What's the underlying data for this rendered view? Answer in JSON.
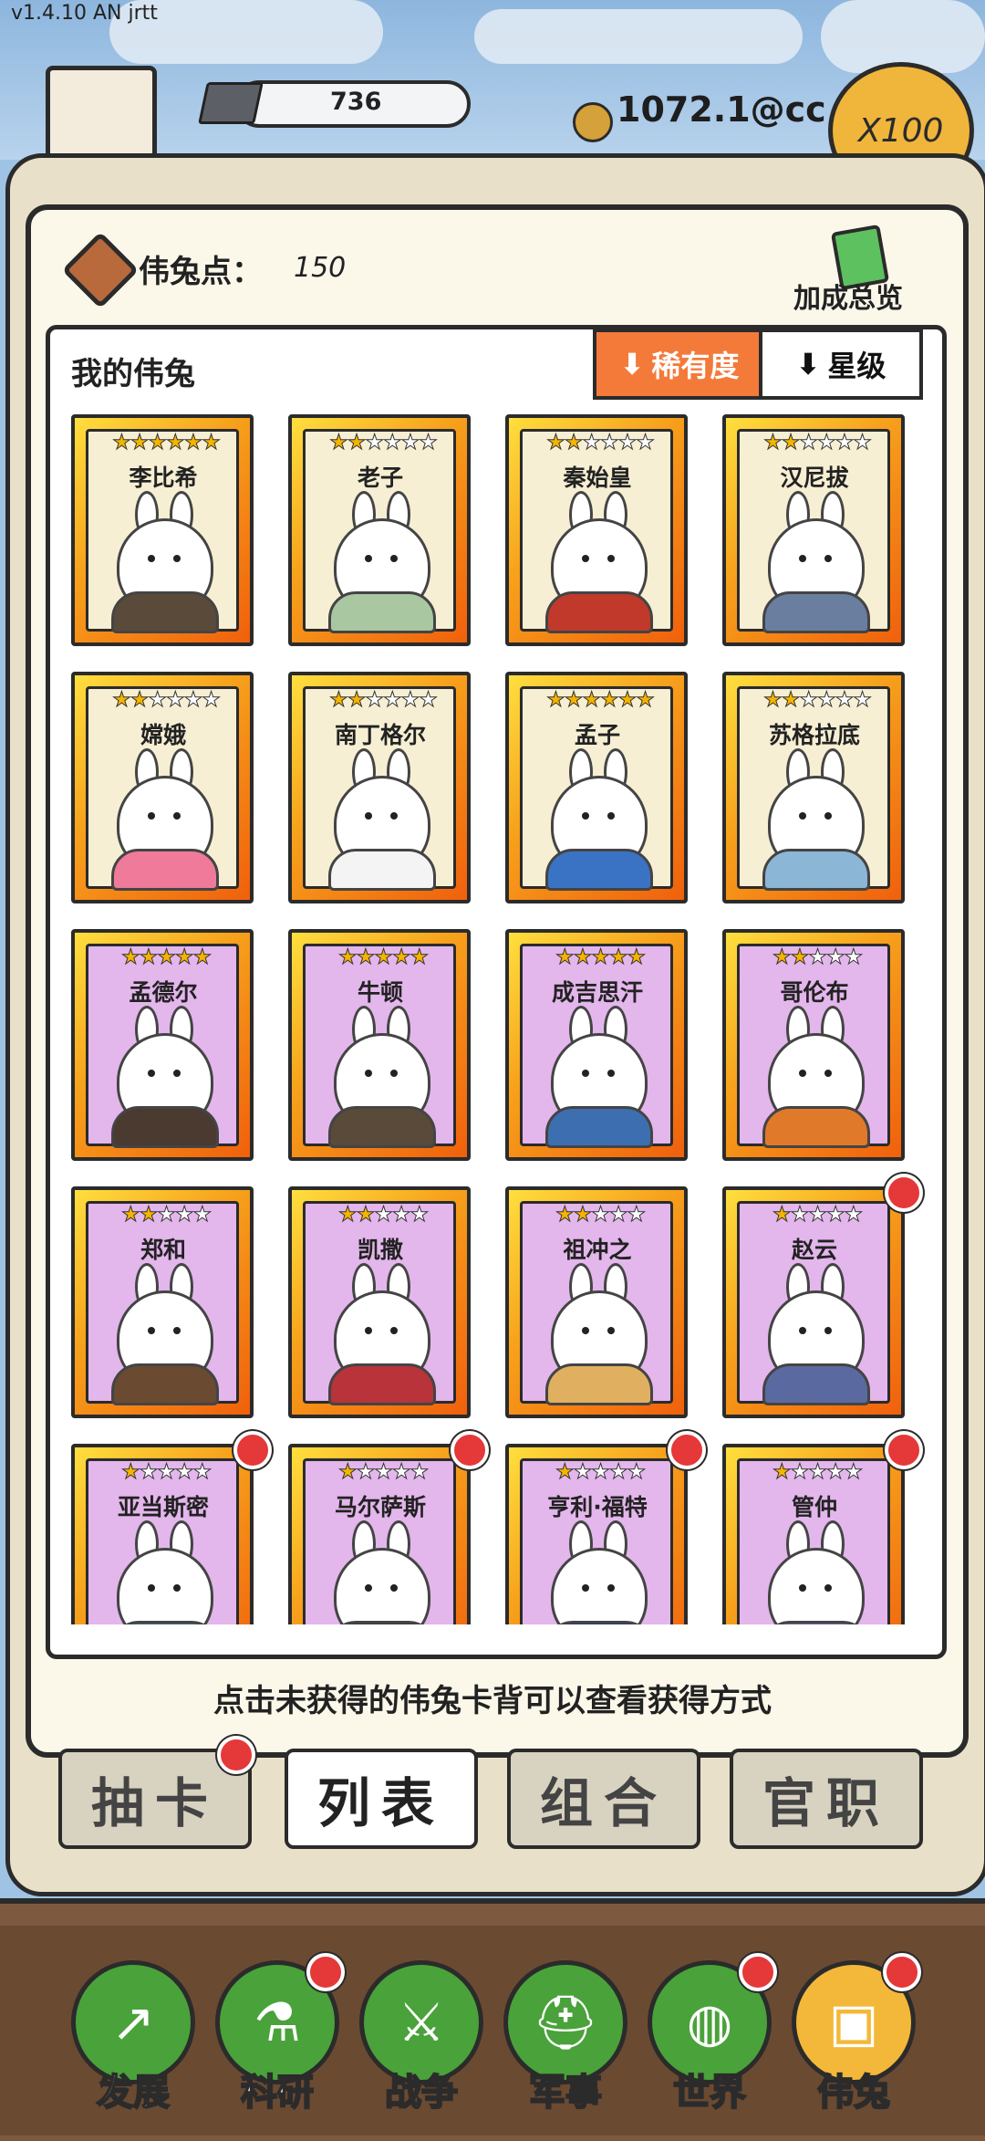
{
  "version": "v1.4.10 AN jrtt",
  "top": {
    "resource": "736",
    "coins": "1072.1@cc",
    "multiplier": "X100"
  },
  "panel": {
    "points_label": "伟兔点：",
    "points_value": "150",
    "bonus_label": "加成总览",
    "list_title": "我的伟兔",
    "sort_rarity": "稀有度",
    "sort_star": "星级",
    "hint": "点击未获得的伟兔卡背可以查看获得方式"
  },
  "cards": [
    {
      "name": "李比希",
      "stars": 6,
      "max": 6,
      "style": "gold",
      "robe": "#5a4a3a",
      "badge": false
    },
    {
      "name": "老子",
      "stars": 2,
      "max": 6,
      "style": "gold",
      "robe": "#a9c7a1",
      "badge": false
    },
    {
      "name": "秦始皇",
      "stars": 2,
      "max": 6,
      "style": "gold",
      "robe": "#c0392b",
      "badge": false
    },
    {
      "name": "汉尼拔",
      "stars": 2,
      "max": 6,
      "style": "gold",
      "robe": "#6a7ea0",
      "badge": false
    },
    {
      "name": "嫦娥",
      "stars": 2,
      "max": 6,
      "style": "gold",
      "robe": "#f07a9a",
      "badge": false
    },
    {
      "name": "南丁格尔",
      "stars": 2,
      "max": 6,
      "style": "gold",
      "robe": "#f4f4f4",
      "badge": false
    },
    {
      "name": "孟子",
      "stars": 6,
      "max": 6,
      "style": "gold",
      "robe": "#3b73c4",
      "badge": false
    },
    {
      "name": "苏格拉底",
      "stars": 2,
      "max": 6,
      "style": "gold",
      "robe": "#8cb6d6",
      "badge": false
    },
    {
      "name": "孟德尔",
      "stars": 5,
      "max": 5,
      "style": "purple",
      "robe": "#4a3a30",
      "badge": false
    },
    {
      "name": "牛顿",
      "stars": 5,
      "max": 5,
      "style": "purple",
      "robe": "#5a4a3a",
      "badge": false
    },
    {
      "name": "成吉思汗",
      "stars": 5,
      "max": 5,
      "style": "purple",
      "robe": "#3d6fb0",
      "badge": false
    },
    {
      "name": "哥伦布",
      "stars": 2,
      "max": 5,
      "style": "purple",
      "robe": "#e07a2a",
      "badge": false
    },
    {
      "name": "郑和",
      "stars": 2,
      "max": 5,
      "style": "purple",
      "robe": "#6a4a30",
      "badge": false
    },
    {
      "name": "凯撒",
      "stars": 2,
      "max": 5,
      "style": "purple",
      "robe": "#b8333a",
      "badge": false
    },
    {
      "name": "祖冲之",
      "stars": 2,
      "max": 5,
      "style": "purple",
      "robe": "#e0b060",
      "badge": false
    },
    {
      "name": "赵云",
      "stars": 1,
      "max": 5,
      "style": "purple",
      "robe": "#5a6aa0",
      "badge": true
    },
    {
      "name": "亚当斯密",
      "stars": 1,
      "max": 5,
      "style": "purple",
      "robe": "#4a6a7a",
      "badge": true
    },
    {
      "name": "马尔萨斯",
      "stars": 1,
      "max": 5,
      "style": "purple",
      "robe": "#3a3a3a",
      "badge": true
    },
    {
      "name": "亨利·福特",
      "stars": 1,
      "max": 5,
      "style": "purple",
      "robe": "#2e3e6e",
      "badge": true
    },
    {
      "name": "管仲",
      "stars": 1,
      "max": 5,
      "style": "purple",
      "robe": "#6a6aa0",
      "badge": true
    }
  ],
  "tabs": [
    "抽卡",
    "列表",
    "组合",
    "官职"
  ],
  "nav": [
    {
      "label": "发展",
      "icon": "growth-arrow-icon",
      "glyph": "↗",
      "badge": false
    },
    {
      "label": "科研",
      "icon": "flask-icon",
      "glyph": "⚗",
      "badge": true
    },
    {
      "label": "战争",
      "icon": "crossed-swords-icon",
      "glyph": "⚔",
      "badge": false
    },
    {
      "label": "军事",
      "icon": "helmet-icon",
      "glyph": "⛑",
      "badge": false
    },
    {
      "label": "世界",
      "icon": "globe-icon",
      "glyph": "◍",
      "badge": true
    },
    {
      "label": "伟兔",
      "icon": "bunny-card-icon",
      "glyph": "▣",
      "badge": true
    }
  ]
}
